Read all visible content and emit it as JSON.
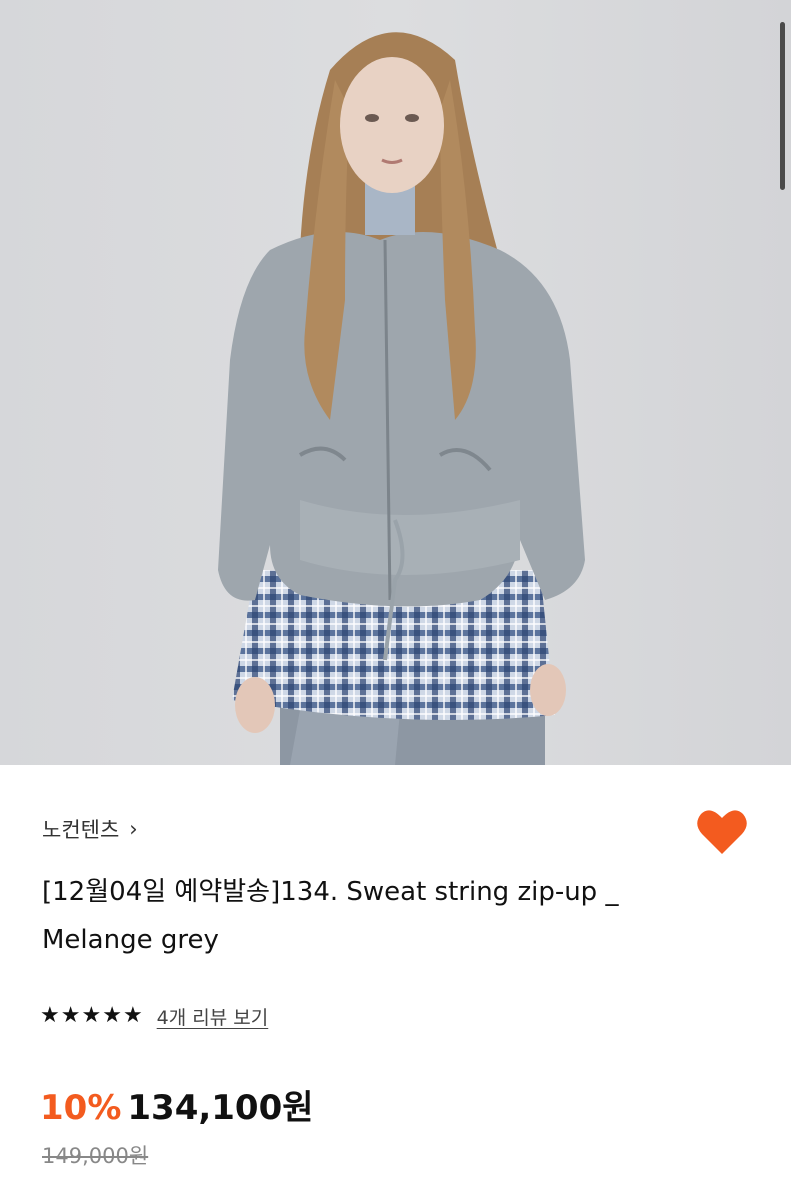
{
  "product_image": {
    "icon": "product-photo"
  },
  "brand": {
    "name": "노컨텐츠",
    "chevron": "›"
  },
  "wishlist": {
    "icon": "heart-icon",
    "color": "#f35b1f",
    "active": true
  },
  "product": {
    "title": "[12월04일 예약발송]134. Sweat string zip-up _ Melange grey"
  },
  "rating": {
    "stars": 5,
    "star_glyph": "★",
    "review_link": "4개 리뷰 보기"
  },
  "price": {
    "discount": "10%",
    "sale_price": "134,100원",
    "original_price": "149,000원"
  },
  "colors": {
    "accent": "#f35b1f",
    "text": "#111111",
    "muted": "#888888"
  }
}
